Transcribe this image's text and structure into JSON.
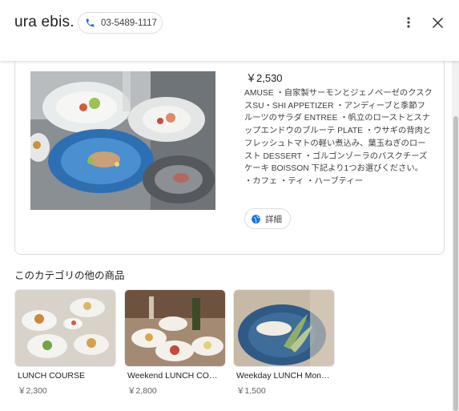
{
  "header": {
    "business_name": "ura ebis.",
    "phone": "03-5489-1117",
    "phone_icon": "phone-icon",
    "menu_icon": "more-vert-icon",
    "close_icon": "close-icon"
  },
  "product": {
    "price": "￥2,530",
    "description": "AMUSE ・自家製サーモンとジェノベーゼのクスクスSU・SHI APPETIZER ・アンディーブと季節フルーツのサラダ ENTREE ・帆立のローストとスナップエンドウのブルーテ PLATE ・ウサギの背肉とフレッシュトマトの軽い煮込み、葉玉ねぎのロースト DESSERT ・ゴルゴンゾーラのバスクチーズケーキ BOISSON 下記より1つお選びください。 ・カフェ ・ティ ・ハーブティー",
    "detail_label": "詳細",
    "detail_icon": "globe-icon"
  },
  "other_items": {
    "title": "このカテゴリの他の商品",
    "items": [
      {
        "name": "LUNCH COURSE",
        "price": "￥2,300"
      },
      {
        "name": "Weekend LUNCH COURSE",
        "price": "￥2,800"
      },
      {
        "name": "Weekday LUNCH Mon-Fri",
        "price": "￥1,500"
      }
    ]
  },
  "colors": {
    "accent_blue": "#1a73e8",
    "text_primary": "#202124",
    "text_secondary": "#5f6368",
    "border": "#dadce0"
  }
}
